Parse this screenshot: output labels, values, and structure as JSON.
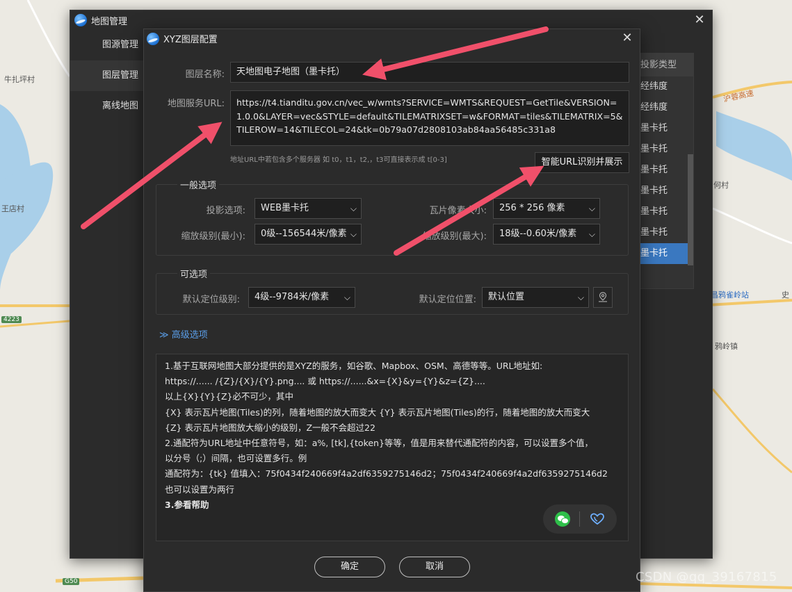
{
  "map": {
    "labels": [
      "牛扎坪村",
      "王店村",
      "沪蓉高速",
      "何村",
      "昌鸦雀岭站",
      "史",
      "鸦岭镇"
    ],
    "roads": [
      "4223",
      "G50"
    ]
  },
  "outer": {
    "title": "地图管理",
    "sidebar": [
      "图源管理",
      "图层管理",
      "离线地图"
    ],
    "list_header": "投影类型",
    "list_items": [
      "经纬度",
      "经纬度",
      "墨卡托",
      "墨卡托",
      "墨卡托",
      "墨卡托",
      "墨卡托",
      "墨卡托",
      "墨卡托"
    ]
  },
  "dialog": {
    "title": "XYZ图层配置",
    "name_label": "图层名称:",
    "name_value": "天地图电子地图（墨卡托）",
    "url_label": "地图服务URL:",
    "url_value": "https://t4.tianditu.gov.cn/vec_w/wmts?SERVICE=WMTS&REQUEST=GetTile&VERSION=1.0.0&LAYER=vec&STYLE=default&TILEMATRIXSET=w&FORMAT=tiles&TILEMATRIX=5&TILEROW=14&TILECOL=24&tk=0b79a07d2808103ab84aa56485c331a8",
    "hint": "地址URL中若包含多个服务器 如 t0，t1，t2,，t3可直接表示成 t[0-3]",
    "smart_button": "智能URL识别并展示",
    "general": {
      "title": "一般选项",
      "projection_label": "投影选项:",
      "projection_value": "WEB墨卡托",
      "tile_size_label": "瓦片像素大小:",
      "tile_size_value": "256 * 256 像素",
      "zoom_min_label": "缩放级别(最小):",
      "zoom_min_value": "0级--156544米/像素",
      "zoom_max_label": "缩放级别(最大):",
      "zoom_max_value": "18级--0.60米/像素"
    },
    "optional": {
      "title": "可选项",
      "default_level_label": "默认定位级别:",
      "default_level_value": "4级--9784米/像素",
      "default_pos_label": "默认定位位置:",
      "default_pos_value": "默认位置"
    },
    "advanced": "≫ 高级选项",
    "help_lines": [
      "1.基于互联网地图大部分提供的是XYZ的服务，如谷歌、Mapbox、OSM、高德等等。URL地址如:",
      "https://...... /{Z}/{X}/{Y}.png....      或      https://......&x={X}&y={Y}&z={Z}....",
      "以上{X}{Y}{Z}必不可少，其中",
      "{X}    表示瓦片地图(Tiles)的列，随着地图的放大而变大          {Y}    表示瓦片地图(Tiles)的行，随着地图的放大而变大",
      "{Z}    表示瓦片地图放大缩小的级别，Z一般不会超过22",
      "2.通配符为URL地址中任意符号，如：a%, [tk],{token}等等，值是用来替代通配符的内容，可以设置多个值，",
      "以分号（;）间隔，也可设置多行。例",
      "通配符为：{tk} 值填入：75f0434f240669f4a2df6359275146d2；75f0434f240669f4a2df6359275146d2",
      "也可以设置为两行"
    ],
    "help_last": "3.参看帮助",
    "ok": "确定",
    "cancel": "取消"
  },
  "watermark": "CSDN @qq_39167815",
  "colors": {
    "arrow": "#f0506a",
    "accent": "#3a78c0",
    "link": "#5a9ee8"
  }
}
